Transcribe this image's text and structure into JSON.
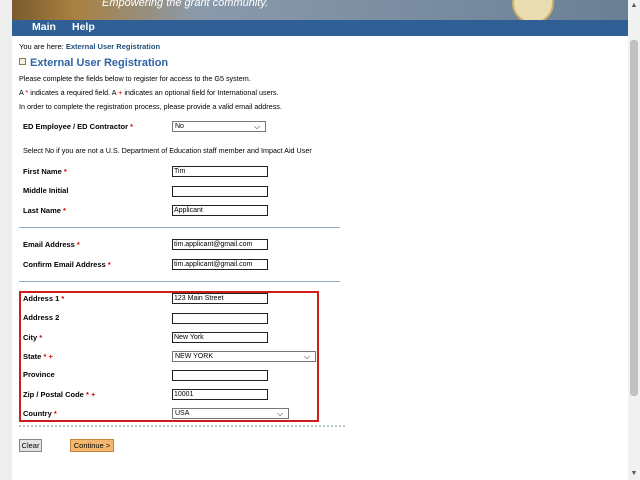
{
  "banner": {
    "tagline": "Empowering the grant community."
  },
  "nav": {
    "main": "Main",
    "help": "Help"
  },
  "breadcrumb": {
    "prefix": "You are here:",
    "current": "External User Registration"
  },
  "page_title": "External User Registration",
  "instructions": {
    "line1": "Please complete the fields below to register for access to the G5 system.",
    "line2_a": "A",
    "line2_star": "*",
    "line2_b": "indicates a required field. A",
    "line2_plus": "+",
    "line2_c": "indicates an optional field for International users.",
    "line3": "In order to complete the registration process, please provide a valid email address."
  },
  "form": {
    "ed_employee": {
      "label": "ED Employee / ED Contractor",
      "req": "*",
      "value": "No"
    },
    "ed_note": "Select No if you are not a U.S. Department of Education staff member and Impact Aid User",
    "first_name": {
      "label": "First Name",
      "req": "*",
      "value": "Tim"
    },
    "middle_initial": {
      "label": "Middle Initial",
      "value": ""
    },
    "last_name": {
      "label": "Last Name",
      "req": "*",
      "value": "Applicant"
    },
    "email": {
      "label": "Email Address",
      "req": "*",
      "value": "tim.applicant@gmail.com"
    },
    "confirm_email": {
      "label": "Confirm Email Address",
      "req": "*",
      "value": "tim.applicant@gmail.com"
    },
    "address1": {
      "label": "Address 1",
      "req": "*",
      "value": "123 Main Street"
    },
    "address2": {
      "label": "Address 2",
      "value": ""
    },
    "city": {
      "label": "City",
      "req": "*",
      "value": "New York"
    },
    "state": {
      "label": "State",
      "req": "*",
      "intl": "+",
      "value": "NEW YORK"
    },
    "province": {
      "label": "Province",
      "value": ""
    },
    "zip": {
      "label": "Zip / Postal Code",
      "req": "*",
      "intl": "+",
      "value": "10001"
    },
    "country": {
      "label": "Country",
      "req": "*",
      "value": "USA"
    }
  },
  "buttons": {
    "clear": "Clear",
    "continue": "Continue >"
  },
  "icons": {
    "select_arrow": "chevron-down-icon",
    "title": "page-icon"
  },
  "colors": {
    "nav": "#2f5f95",
    "title": "#2f64a5",
    "highlight_box": "#d11a1a",
    "required": "#cc0000",
    "continue_btn": "#f5b76d"
  }
}
